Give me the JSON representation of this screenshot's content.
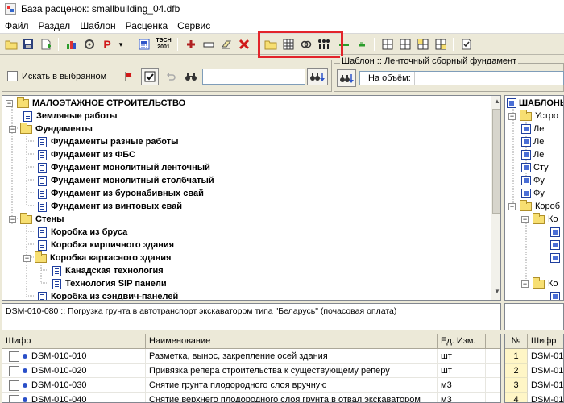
{
  "window": {
    "title": "База расценок:  smallbuilding_04.dfb"
  },
  "menu": [
    "Файл",
    "Раздел",
    "Шаблон",
    "Расценка",
    "Сервис"
  ],
  "toolbar": {
    "p_label": "P",
    "tesn_label_1": "ТЭСН",
    "tesn_label_2": "2001"
  },
  "filter": {
    "search_in_selected_label": "Искать в выбранном",
    "search_value": ""
  },
  "template": {
    "title": "Шаблон :: Ленточный сборный фундамент",
    "per_volume_label": "На объём:"
  },
  "tree": [
    "МАЛОЭТАЖНОЕ СТРОИТЕЛЬСТВО",
    "Земляные  работы",
    "Фундаменты",
    "Фундаменты разные работы",
    "Фундамент из ФБС",
    "Фундамент монолитный ленточный",
    "Фундамент монолитный столбчатый",
    "Фундамент из буронабивных свай",
    "Фундамент из винтовых свай",
    "Стены",
    "Коробка из бруса",
    "Коробка кирпичного здания",
    "Коробка каркасного здания",
    "Канадская технология",
    "Технология SIP панели",
    "Коробка из сэндвич-панелей"
  ],
  "right_tree": [
    "ШАБЛОНЫ",
    "Устро",
    "Ле",
    "Ле",
    "Ле",
    "Сту",
    "Фу",
    "Фу",
    "Короб",
    "Ко",
    "",
    "",
    "",
    "Ко",
    ""
  ],
  "description": "DSM-010-080 :: Погрузка грунта в автотранспорт экскаватором типа \"Беларусь\" (почасовая оплата)",
  "grid": {
    "columns": [
      "Шифр",
      "Наименование",
      "Ед. Изм."
    ],
    "rows": [
      [
        "DSM-010-010",
        "Разметка, вынос, закрепление осей здания",
        "шт"
      ],
      [
        "DSM-010-020",
        "Привязка репера строительства к существующему реперу",
        "шт"
      ],
      [
        "DSM-010-030",
        "Снятие грунта плодородного слоя вручную",
        "м3"
      ],
      [
        "DSM-010-040",
        "Снятие верхнего плодородного слоя грунта в отвал экскаватором",
        "м3"
      ]
    ]
  },
  "grid_right": {
    "columns": [
      "№",
      "Шифр"
    ],
    "rows": [
      [
        "1",
        "DSM-01"
      ],
      [
        "2",
        "DSM-01"
      ],
      [
        "3",
        "DSM-01"
      ],
      [
        "4",
        "DSM-01"
      ]
    ]
  },
  "colors": {
    "highlight": "#e3242b",
    "folder": "#f7df72",
    "accent_blue": "#1f3f9e"
  }
}
